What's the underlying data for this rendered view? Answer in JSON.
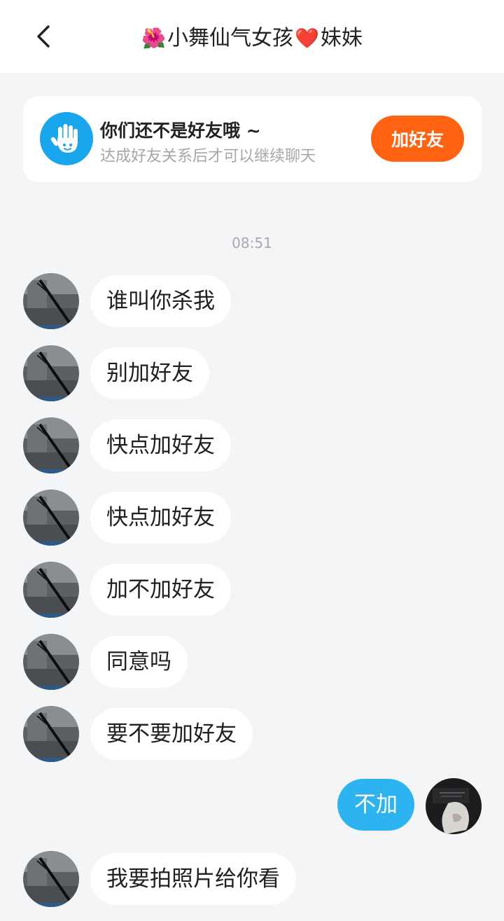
{
  "header": {
    "title_prefix_emoji": "🌺",
    "title_name": "小舞仙气女孩",
    "title_heart_emoji": "❤️",
    "title_suffix": "妹妹"
  },
  "friend_notice": {
    "title": "你们还不是好友哦 ~",
    "subtitle": "达成好友关系后才可以继续聊天",
    "button_label": "加好友",
    "icon": "hand-wave-icon",
    "button_color": "#ff6211"
  },
  "timestamp": "08:51",
  "incoming_messages": [
    "谁叫你杀我",
    "别加好友",
    "快点加好友",
    "快点加好友",
    "加不加好友",
    "同意吗",
    "要不要加好友"
  ],
  "outgoing_message": "不加",
  "last_incoming_message": "我要拍照片给你看",
  "colors": {
    "outgoing_bubble": "#2db4f0",
    "background": "#f4f5f7"
  }
}
